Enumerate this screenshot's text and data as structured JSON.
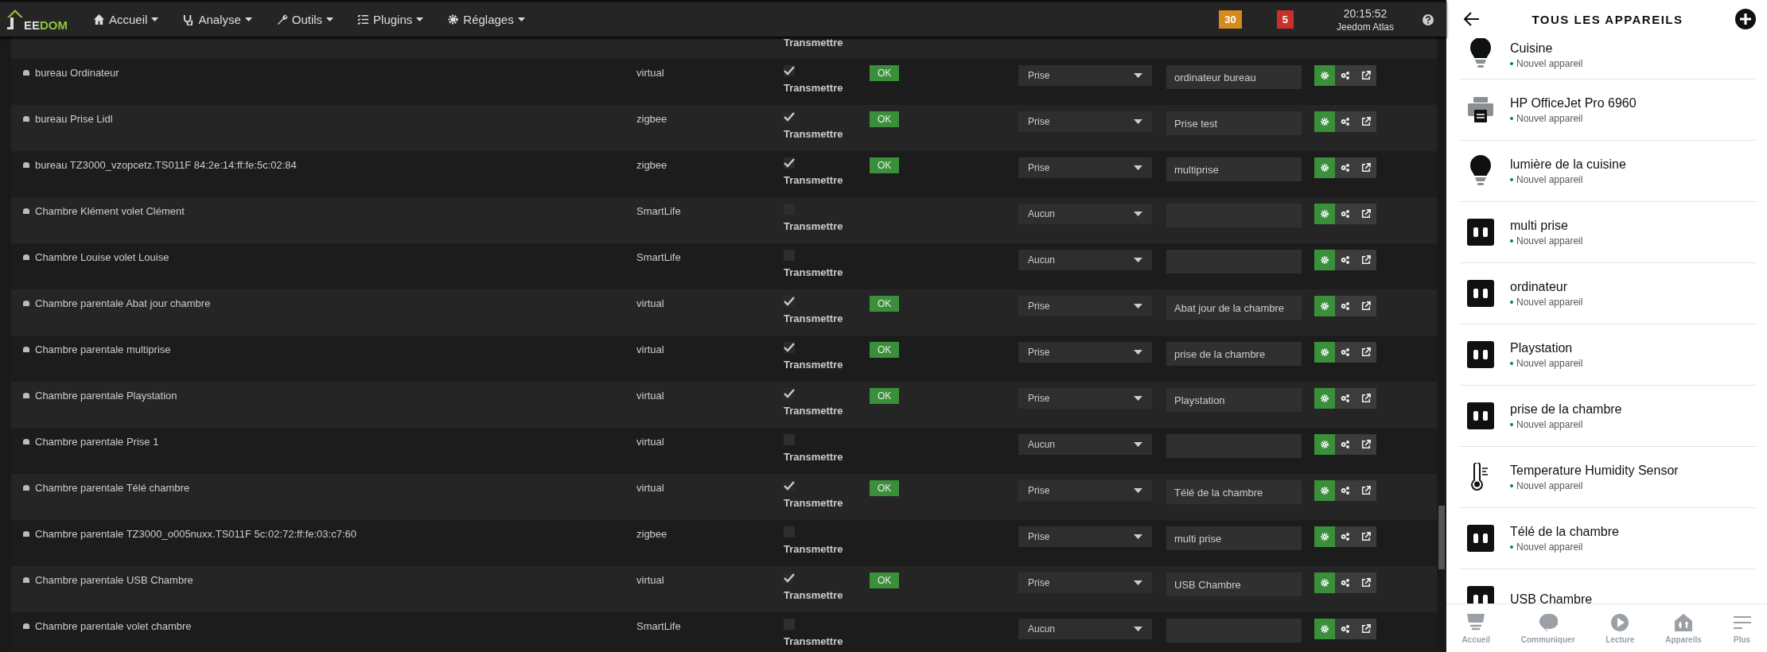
{
  "topbar": {
    "logo_lead": "EE",
    "logo_tail": "DOM",
    "menus": [
      {
        "label": "Accueil",
        "kind": "home"
      },
      {
        "label": "Analyse",
        "kind": "stethoscope"
      },
      {
        "label": "Outils",
        "kind": "wrench"
      },
      {
        "label": "Plugins",
        "kind": "list"
      },
      {
        "label": "Réglages",
        "kind": "gear"
      }
    ],
    "badges": [
      {
        "text": "30",
        "color": "#d68a1e"
      },
      {
        "text": "5",
        "color": "#c9302c"
      }
    ],
    "time": "20:15:52",
    "user": "Jeedom Atlas"
  },
  "devices": [
    {
      "kind": "partial",
      "transmit_label": "Transmettre"
    },
    {
      "kind": "row",
      "name": "bureau Ordinateur",
      "plugin": "virtual",
      "transmit": true,
      "transmit_label": "Transmettre",
      "status": "OK",
      "type": "Prise",
      "alias": "ordinateur bureau"
    },
    {
      "kind": "row",
      "name": "bureau Prise Lidl",
      "plugin": "zigbee",
      "transmit": true,
      "transmit_label": "Transmettre",
      "status": "OK",
      "type": "Prise",
      "alias": "Prise test"
    },
    {
      "kind": "row",
      "name": "bureau TZ3000_vzopcetz.TS011F 84:2e:14:ff:fe:5c:02:84",
      "plugin": "zigbee",
      "transmit": true,
      "transmit_label": "Transmettre",
      "status": "OK",
      "type": "Prise",
      "alias": "multiprise"
    },
    {
      "kind": "row",
      "name": "Chambre Klément volet Clément",
      "plugin": "SmartLife",
      "transmit": false,
      "transmit_label": "Transmettre",
      "type": "Aucun"
    },
    {
      "kind": "row",
      "name": "Chambre Louise volet Louise",
      "plugin": "SmartLife",
      "transmit": false,
      "transmit_label": "Transmettre",
      "type": "Aucun"
    },
    {
      "kind": "row",
      "name": "Chambre parentale Abat jour chambre",
      "plugin": "virtual",
      "transmit": true,
      "transmit_label": "Transmettre",
      "status": "OK",
      "type": "Prise",
      "alias": "Abat jour de la chambre"
    },
    {
      "kind": "row",
      "name": "Chambre parentale multiprise",
      "plugin": "virtual",
      "transmit": true,
      "transmit_label": "Transmettre",
      "status": "OK",
      "type": "Prise",
      "alias": "prise de la chambre"
    },
    {
      "kind": "row",
      "name": "Chambre parentale Playstation",
      "plugin": "virtual",
      "transmit": true,
      "transmit_label": "Transmettre",
      "status": "OK",
      "type": "Prise",
      "alias": "Playstation"
    },
    {
      "kind": "row",
      "name": "Chambre parentale Prise 1",
      "plugin": "virtual",
      "transmit": false,
      "transmit_label": "Transmettre",
      "type": "Aucun"
    },
    {
      "kind": "row",
      "name": "Chambre parentale Télé chambre",
      "plugin": "virtual",
      "transmit": true,
      "transmit_label": "Transmettre",
      "status": "OK",
      "type": "Prise",
      "alias": "Télé de la chambre"
    },
    {
      "kind": "row",
      "name": "Chambre parentale TZ3000_o005nuxx.TS011F 5c:02:72:ff:fe:03:c7:60",
      "plugin": "zigbee",
      "transmit": false,
      "transmit_label": "Transmettre",
      "type": "Prise",
      "alias": "multi prise"
    },
    {
      "kind": "row",
      "name": "Chambre parentale USB Chambre",
      "plugin": "virtual",
      "transmit": true,
      "transmit_label": "Transmettre",
      "status": "OK",
      "type": "Prise",
      "alias": "USB Chambre"
    },
    {
      "kind": "row",
      "name": "Chambre parentale volet chambre",
      "plugin": "SmartLife",
      "transmit": false,
      "transmit_label": "Transmettre",
      "type": "Aucun"
    }
  ],
  "alexa": {
    "title": "TOUS LES APPAREILS",
    "devices": [
      {
        "name": "Cuisine",
        "status": "Nouvel appareil",
        "kind": "bulb"
      },
      {
        "name": "HP OfficeJet Pro 6960",
        "status": "Nouvel appareil",
        "kind": "printer"
      },
      {
        "name": "lumière de la cuisine",
        "status": "Nouvel appareil",
        "kind": "bulb"
      },
      {
        "name": "multi prise",
        "status": "Nouvel appareil",
        "kind": "plug"
      },
      {
        "name": "ordinateur",
        "status": "Nouvel appareil",
        "kind": "plug"
      },
      {
        "name": "Playstation",
        "status": "Nouvel appareil",
        "kind": "plug"
      },
      {
        "name": "prise de la chambre",
        "status": "Nouvel appareil",
        "kind": "plug"
      },
      {
        "name": "Temperature Humidity Sensor",
        "status": "Nouvel appareil",
        "kind": "thermometer"
      },
      {
        "name": "Télé de la chambre",
        "status": "Nouvel appareil",
        "kind": "plug"
      },
      {
        "name": "USB Chambre",
        "kind": "plug"
      }
    ],
    "nav": [
      {
        "label": "Accueil",
        "kind": "home"
      },
      {
        "label": "Communiquer",
        "kind": "chat"
      },
      {
        "label": "Lecture",
        "kind": "play"
      },
      {
        "label": "Appareils",
        "kind": "devices"
      },
      {
        "label": "Plus",
        "kind": "more"
      }
    ]
  }
}
